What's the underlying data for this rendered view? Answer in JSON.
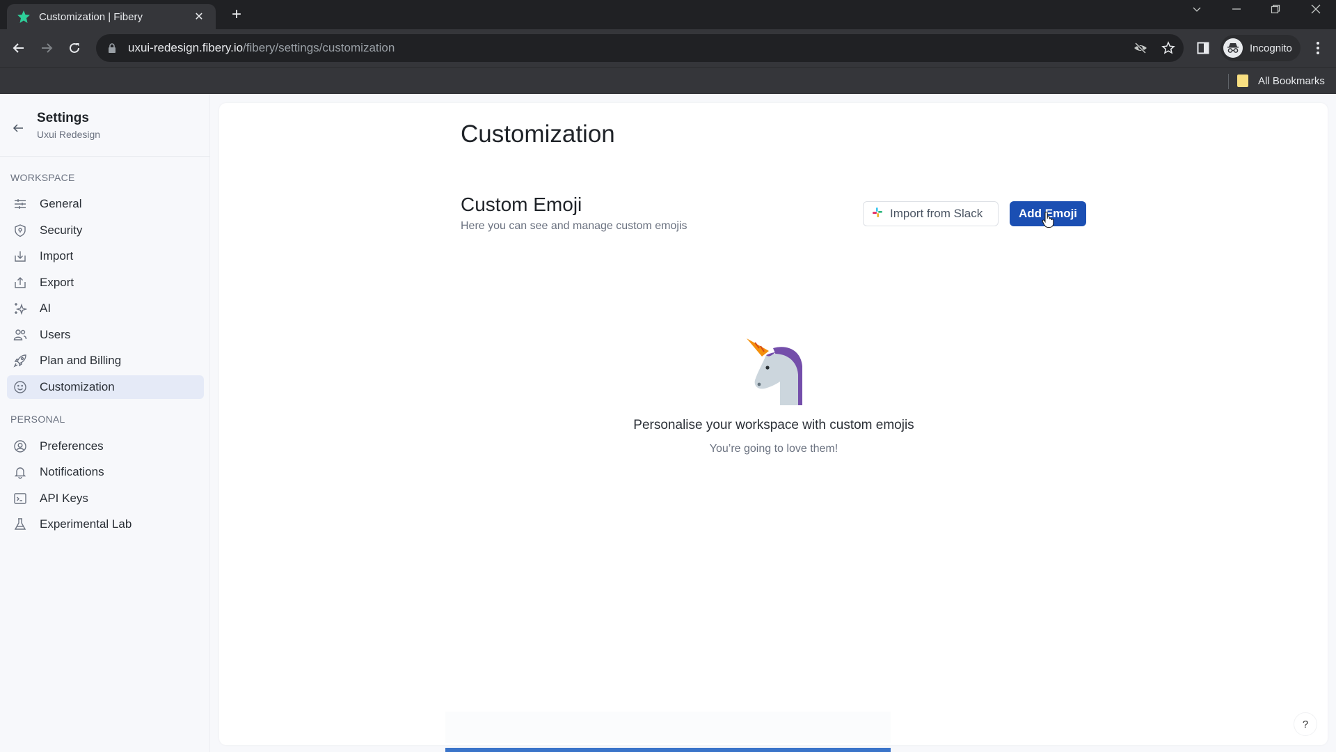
{
  "browser": {
    "tab_title": "Customization | Fibery",
    "url_host": "uxui-redesign.fibery.io",
    "url_path": "/fibery/settings/customization",
    "profile_label": "Incognito",
    "bookmarks_label": "All Bookmarks"
  },
  "sidebar": {
    "title": "Settings",
    "subtitle": "Uxui Redesign",
    "sections": [
      {
        "label": "WORKSPACE",
        "items": [
          {
            "label": "General",
            "icon": "sliders-icon"
          },
          {
            "label": "Security",
            "icon": "shield-icon"
          },
          {
            "label": "Import",
            "icon": "import-icon"
          },
          {
            "label": "Export",
            "icon": "export-icon"
          },
          {
            "label": "AI",
            "icon": "sparkles-icon"
          },
          {
            "label": "Users",
            "icon": "users-icon"
          },
          {
            "label": "Plan and Billing",
            "icon": "rocket-icon"
          },
          {
            "label": "Customization",
            "icon": "smiley-icon",
            "active": true
          }
        ]
      },
      {
        "label": "PERSONAL",
        "items": [
          {
            "label": "Preferences",
            "icon": "user-circle-icon"
          },
          {
            "label": "Notifications",
            "icon": "bell-icon"
          },
          {
            "label": "API Keys",
            "icon": "terminal-icon"
          },
          {
            "label": "Experimental Lab",
            "icon": "flask-icon"
          }
        ]
      }
    ]
  },
  "main": {
    "title": "Customization",
    "section_title": "Custom Emoji",
    "section_subtitle": "Here you can see and manage custom emojis",
    "import_button": "Import from Slack",
    "add_button": "Add Emoji",
    "empty_title": "Personalise your workspace with custom emojis",
    "empty_subtitle": "You’re going to love them!",
    "help_label": "?"
  },
  "colors": {
    "primary": "#1b4fb3",
    "active_nav": "#e5eaf7",
    "progress": "#3a74c9"
  },
  "loading_progress": 1.0
}
